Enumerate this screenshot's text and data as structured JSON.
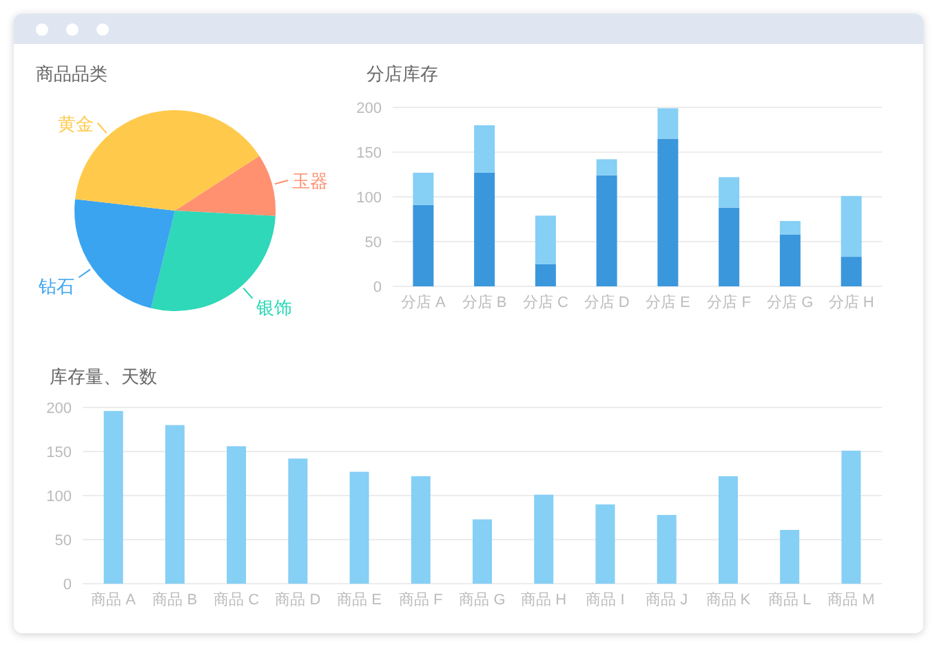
{
  "panels": [
    {
      "title": "商品品类",
      "chart_data": {
        "type": "pie",
        "categories": [
          "玉器",
          "银饰",
          "钻石",
          "黄金"
        ],
        "colors": [
          "#ff9070",
          "#2ed8b8",
          "#3aa4f0",
          "#ffca4c"
        ],
        "series": [
          {
            "values": [
              10,
              28,
              23,
              39
            ]
          }
        ]
      }
    },
    {
      "title": "分店库存",
      "chart_data": {
        "type": "bar",
        "stacked": true,
        "grid": true,
        "categories": [
          "分店 A",
          "分店 B",
          "分店 C",
          "分店 D",
          "分店 E",
          "分店 F",
          "分店 G",
          "分店 H"
        ],
        "ylim": [
          0,
          200
        ],
        "yticks": [
          0,
          50,
          100,
          150,
          200
        ],
        "series": [
          {
            "color": "#3a97dc",
            "values": [
              91,
              127,
              25,
              124,
              165,
              88,
              58,
              33
            ]
          },
          {
            "color": "#86cff5",
            "values": [
              36,
              53,
              54,
              18,
              34,
              34,
              15,
              68
            ]
          }
        ]
      }
    },
    {
      "title": "库存量、天数",
      "chart_data": {
        "type": "bar",
        "categories": [
          "商品 A",
          "商品 B",
          "商品 C",
          "商品 D",
          "商品 E",
          "商品 F",
          "商品 G",
          "商品 H",
          "商品 I",
          "商品 J",
          "商品 K",
          "商品 L",
          "商品 M"
        ],
        "grid": true,
        "ylim": [
          0,
          200
        ],
        "yticks": [
          0,
          50,
          100,
          150,
          200
        ],
        "series": [
          {
            "color": "#86cff5",
            "values": [
              196,
              180,
              156,
              142,
              127,
              122,
              73,
              101,
              90,
              78,
              122,
              61,
              151
            ]
          }
        ]
      }
    }
  ]
}
